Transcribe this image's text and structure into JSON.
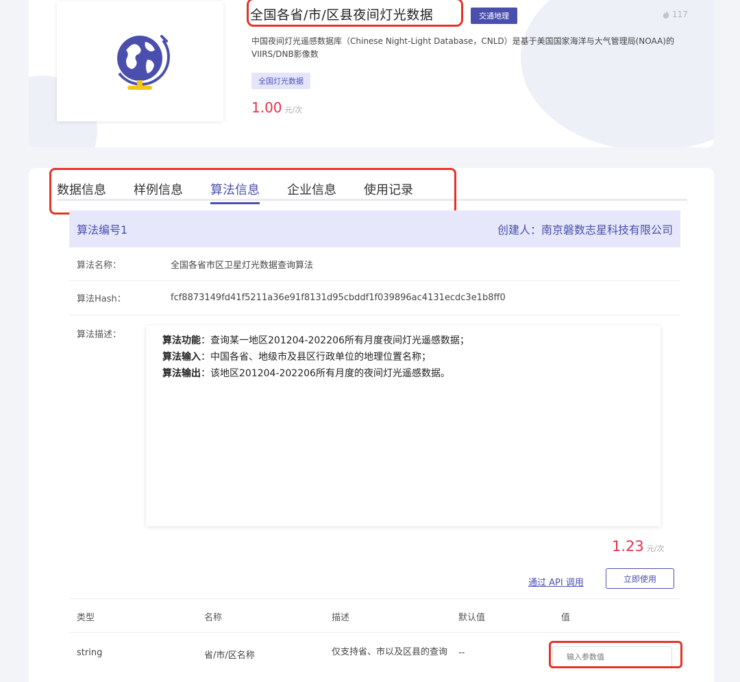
{
  "product": {
    "title": "全国各省/市/区县夜间灯光数据",
    "category": "交通地理",
    "hot_count": "117",
    "description": "中国夜间灯光遥感数据库（Chinese Night-Light Database，CNLD）是基于美国国家海洋与大气管理局(NOAA)的VIIRS/DNB影像数",
    "sub_tag": "全国灯光数据",
    "price": "1.00",
    "price_unit": "元/次"
  },
  "tabs": [
    {
      "label": "数据信息"
    },
    {
      "label": "样例信息"
    },
    {
      "label": "算法信息"
    },
    {
      "label": "企业信息"
    },
    {
      "label": "使用记录"
    }
  ],
  "algorithm": {
    "number": "算法编号1",
    "creator": "创建人：南京磐数志星科技有限公司",
    "name_label": "算法名称：",
    "name": "全国各省市区卫星灯光数据查询算法",
    "hash_label": "算法Hash：",
    "hash": "fcf8873149fd41f5211a36e91f8131d95cbddf1f039896ac4131ecdc3e1b8ff0",
    "desc_label": "算法描述：",
    "desc_lines": [
      {
        "key": "算法功能",
        "text": "：查询某一地区201204-202206所有月度夜间灯光遥感数据；"
      },
      {
        "key": "算法输入",
        "text": "：中国各省、地级市及县区行政单位的地理位置名称；"
      },
      {
        "key": "算法输出",
        "text": "：该地区201204-202206所有月度的夜间灯光遥感数据。"
      }
    ],
    "price": "1.23",
    "price_unit": "元/次",
    "api_link": "通过 API 调用",
    "use_button": "立即使用"
  },
  "params": {
    "headers": {
      "type": "类型",
      "name": "名称",
      "desc": "描述",
      "default": "默认值",
      "value": "值"
    },
    "rows": [
      {
        "type": "string",
        "name": "省/市/区名称",
        "desc": "仅支持省、市以及区县的查询",
        "default": "--",
        "placeholder": "输入参数值"
      }
    ]
  },
  "colors": {
    "accent": "#4a4fad",
    "price": "#e8304a",
    "highlight": "#e53227"
  }
}
